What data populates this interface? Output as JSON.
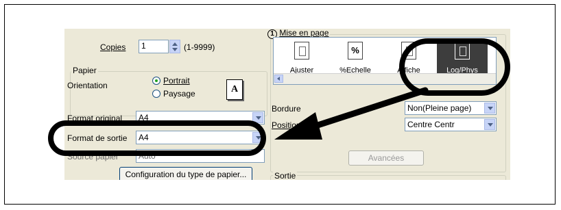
{
  "copies": {
    "label": "Copies",
    "value": "1",
    "range": "(1-9999)"
  },
  "paper": {
    "group_label": "Papier",
    "orientation_label": "Orientation",
    "portrait_label": "Portrait",
    "landscape_label": "Paysage",
    "selected_orientation": "Portrait"
  },
  "original_format": {
    "label": "Format original",
    "value": "A4"
  },
  "output_format": {
    "label": "Format de sortie",
    "value": "A4"
  },
  "paper_source": {
    "label": "Source papier",
    "value": "Auto"
  },
  "paper_type_button": "Configuration du type de papier...",
  "layout": {
    "marker": "1",
    "group_label": "Mise en page",
    "items": [
      {
        "label": "Ajuster",
        "icon": "fit-page-icon"
      },
      {
        "label": "%Echelle",
        "icon": "percent-scale-icon"
      },
      {
        "label": "Affiche",
        "icon": "poster-icon"
      },
      {
        "label": "Log/Phys",
        "icon": "log-phys-icon"
      }
    ],
    "selected": "Log/Phys"
  },
  "border": {
    "label": "Bordure",
    "value": "Non(Pleine page)"
  },
  "position": {
    "label": "Position",
    "value": "Centre Centr"
  },
  "advanced_button": "Avancées",
  "output_group_label": "Sortie",
  "colors": {
    "dialog_bg": "#ece9d8",
    "selection": "#3d3d3d",
    "callout": "#000000"
  }
}
